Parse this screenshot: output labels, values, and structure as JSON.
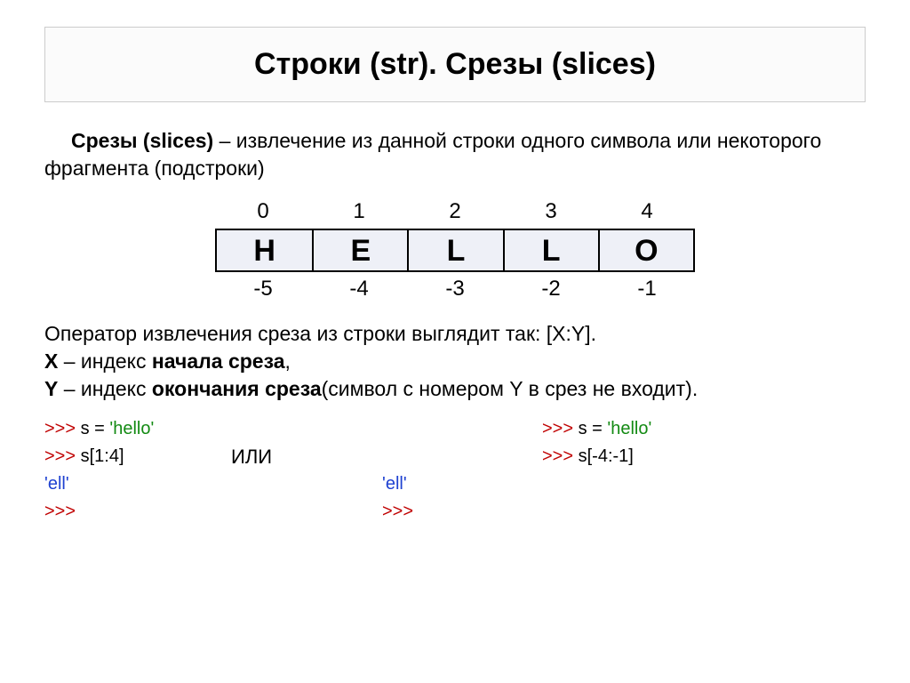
{
  "title": "Строки (str). Срезы (slices)",
  "intro": {
    "term": "Срезы (slices)",
    "rest": " – извлечение из данной строки одного символа или некоторого фрагмента (подстроки)"
  },
  "indices": {
    "pos": [
      "0",
      "1",
      "2",
      "3",
      "4"
    ],
    "letters": [
      "H",
      "E",
      "L",
      "L",
      "O"
    ],
    "neg": [
      "-5",
      "-4",
      "-3",
      "-2",
      "-1"
    ]
  },
  "explain": {
    "line1_a": "Оператор извлечения среза из строки выглядит так: [X:Y].",
    "line2_a": "X",
    "line2_b": " – индекс ",
    "line2_c": "начала среза",
    "line2_d": ",",
    "line3_a": "Y",
    "line3_b": " – индекс ",
    "line3_c": "окончания среза",
    "line3_d": "(символ с номером Y в срез не входит)."
  },
  "code": {
    "prompt": ">>> ",
    "assign_s": "s = ",
    "hello_lit": "'hello'",
    "slice_pos": "s[1:4]",
    "slice_neg": "s[-4:-1]",
    "result": "'ell'",
    "or_word": "ИЛИ"
  }
}
